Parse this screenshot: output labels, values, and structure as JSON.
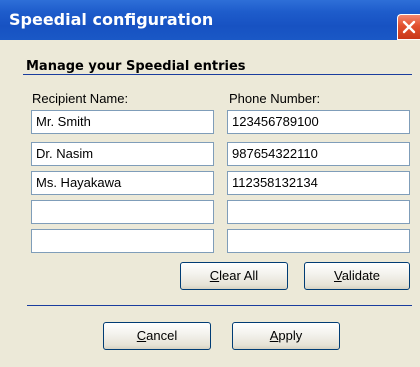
{
  "window": {
    "title": "Speedial configuration"
  },
  "section": {
    "title": "Manage your Speedial entries"
  },
  "columns": {
    "name_header": "Recipient Name:",
    "phone_header": "Phone Number:"
  },
  "entries": [
    {
      "name": "Mr. Smith",
      "phone": "123456789100"
    },
    {
      "name": "Dr. Nasim",
      "phone": "987654322110"
    },
    {
      "name": "Ms. Hayakawa",
      "phone": "112358132134"
    },
    {
      "name": "",
      "phone": ""
    },
    {
      "name": "",
      "phone": ""
    }
  ],
  "buttons": {
    "clear_all": {
      "mnemonic": "C",
      "rest": "lear All"
    },
    "validate": {
      "mnemonic": "V",
      "rest": "alidate"
    },
    "cancel": {
      "mnemonic": "C",
      "rest": "ancel"
    },
    "apply": {
      "mnemonic": "A",
      "rest": "pply"
    }
  },
  "icons": {
    "close": "close-icon"
  },
  "colors": {
    "titlebar": "#1752C2",
    "dialog_bg": "#ECE9D8",
    "close_button": "#E2502E",
    "separator": "#1A3D9E",
    "field_border": "#7F9DB9"
  }
}
